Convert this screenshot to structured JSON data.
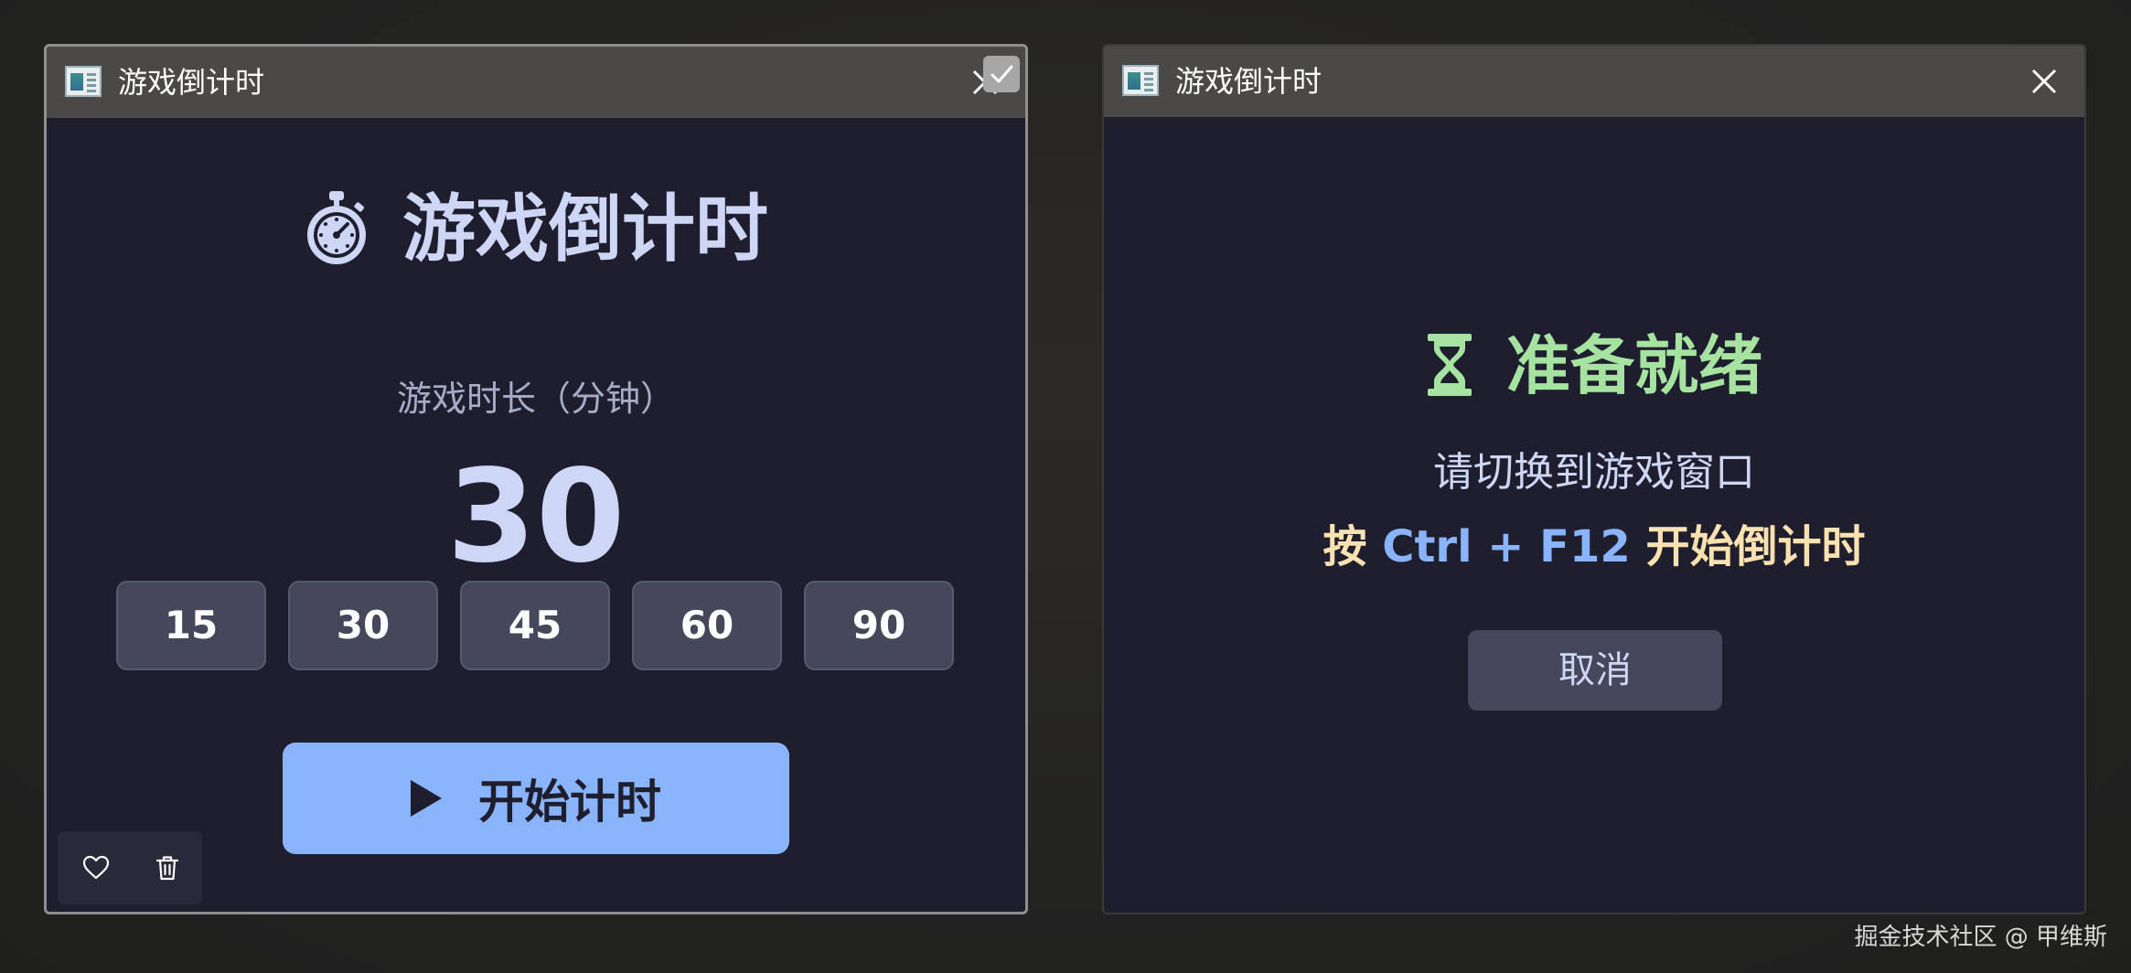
{
  "setup_window": {
    "title": "游戏倒计时",
    "heading": "游戏倒计时",
    "duration_label": "游戏时长（分钟）",
    "duration_value": "30",
    "presets": [
      "15",
      "30",
      "45",
      "60",
      "90"
    ],
    "start_label": "开始计时"
  },
  "ready_window": {
    "title": "游戏倒计时",
    "heading": "准备就绪",
    "instruction": "请切换到游戏窗口",
    "hotkey_prefix": "按",
    "hotkey": "Ctrl + F12",
    "hotkey_suffix": "开始倒计时",
    "cancel_label": "取消"
  },
  "watermark": "掘金技术社区 @ 甲维斯",
  "icons": {
    "app": "app-window-icon",
    "close": "close-icon",
    "check": "check-icon",
    "stopwatch": "stopwatch-icon",
    "hourglass": "hourglass-icon",
    "play": "play-icon",
    "heart": "heart-icon",
    "trash": "trash-icon"
  },
  "colors": {
    "window_bg": "#1f1e2f",
    "titlebar_bg": "#4a4947",
    "text_primary": "#cdd6f4",
    "text_muted": "#a6adc8",
    "preset_bg": "#45475a",
    "start_button_bg": "#89b4fa",
    "ready_green": "#a6e3a1",
    "hotkey_yellow": "#f9e2af",
    "hotkey_blue": "#89b4fa"
  }
}
